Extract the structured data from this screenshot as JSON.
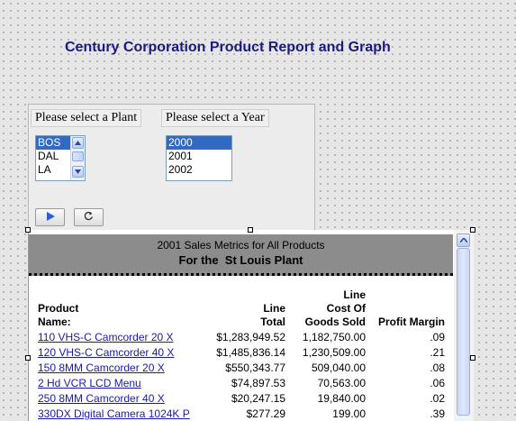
{
  "report_title": "Century Corporation Product Report and Graph",
  "plant_selector": {
    "label": "Please select a Plant",
    "options": [
      "BOS",
      "DAL",
      "LA"
    ],
    "selected": "BOS"
  },
  "year_selector": {
    "label": "Please select a Year",
    "options": [
      "2000",
      "2001",
      "2002"
    ],
    "selected": "2000"
  },
  "buttons": {
    "run_icon": "play-icon",
    "reset_icon": "refresh-icon"
  },
  "report": {
    "subtitle": "2001 Sales Metrics for All Products",
    "plant_heading": "For the  St Louis Plant",
    "columns": {
      "product": [
        "Product",
        "Name:"
      ],
      "line_total": [
        "Line",
        "Total"
      ],
      "line_cost": [
        "Line",
        "Cost Of",
        "Goods Sold"
      ],
      "profit_margin": "Profit Margin"
    },
    "rows": [
      {
        "name": "110 VHS-C Camcorder 20 X",
        "total": "$1,283,949.52",
        "cost": "1,182,750.00",
        "margin": ".09"
      },
      {
        "name": "120 VHS-C Camcorder 40 X",
        "total": "$1,485,836.14",
        "cost": "1,230,509.00",
        "margin": ".21"
      },
      {
        "name": "150 8MM Camcorder 20 X",
        "total": "$550,343.77",
        "cost": "509,040.00",
        "margin": ".08"
      },
      {
        "name": "2 Hd VCR LCD Menu",
        "total": "$74,897.53",
        "cost": "70,563.00",
        "margin": ".06"
      },
      {
        "name": "250 8MM Camcorder 40 X",
        "total": "$20,247.15",
        "cost": "19,840.00",
        "margin": ".02"
      },
      {
        "name": "330DX Digital Camera 1024K P",
        "total": "$277.29",
        "cost": "199.00",
        "margin": ".39"
      }
    ]
  }
}
